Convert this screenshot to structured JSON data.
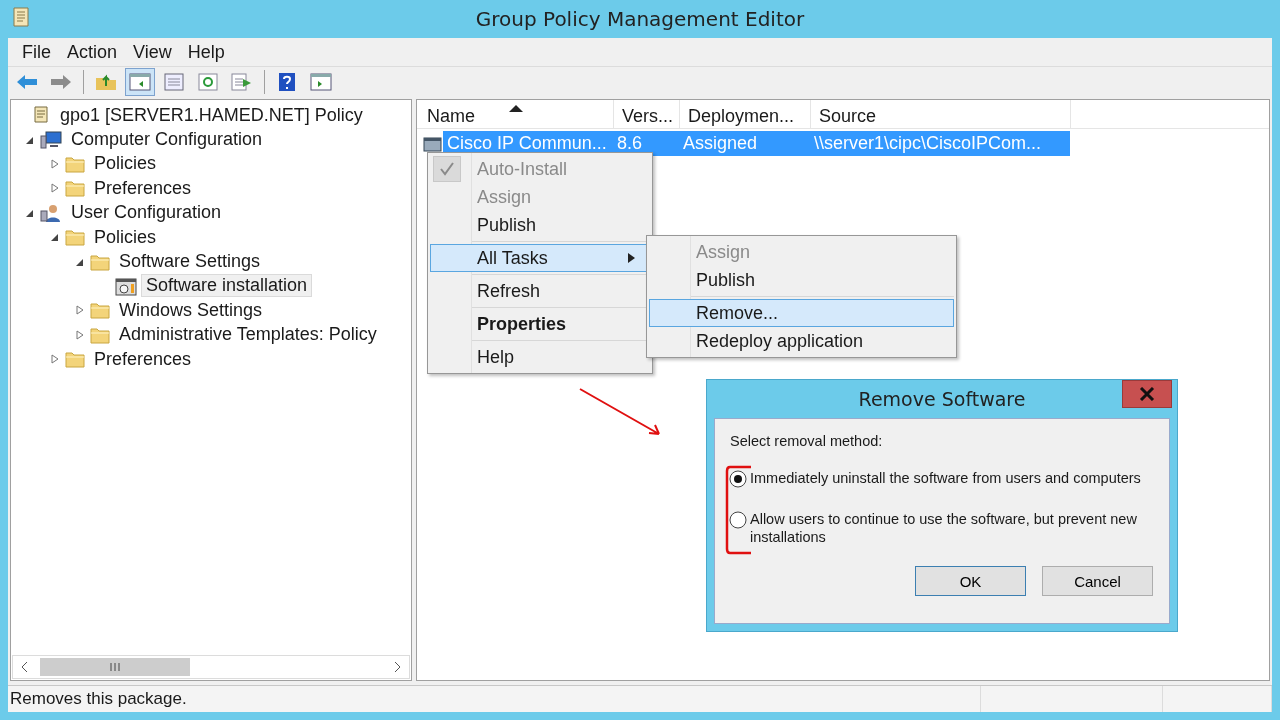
{
  "window": {
    "title": "Group Policy Management Editor"
  },
  "menu_bar": [
    "File",
    "Action",
    "View",
    "Help"
  ],
  "toolbar": [
    {
      "pressed": false
    },
    {
      "pressed": false
    },
    {
      "pressed": false
    },
    {
      "pressed": true
    },
    {
      "pressed": false
    },
    {
      "pressed": false
    },
    {
      "pressed": false
    },
    {
      "pressed": false
    },
    {
      "pressed": false
    }
  ],
  "tree": {
    "label": "gpo1 [SERVER1.HAMED.NET] Policy",
    "kind": "policy",
    "selected": false,
    "children": [
      {
        "label": "Computer Configuration",
        "kind": "computer",
        "expanded": true,
        "selected": false,
        "children": [
          {
            "label": "Policies",
            "kind": "folder",
            "expanded": false,
            "selected": false
          },
          {
            "label": "Preferences",
            "kind": "folder",
            "expanded": false,
            "selected": false
          }
        ]
      },
      {
        "label": "User Configuration",
        "kind": "user",
        "expanded": true,
        "selected": false,
        "children": [
          {
            "label": "Policies",
            "kind": "folder",
            "expanded": true,
            "selected": false,
            "children": [
              {
                "label": "Software Settings",
                "kind": "folder",
                "expanded": true,
                "selected": false,
                "children": [
                  {
                    "label": "Software installation",
                    "kind": "software",
                    "selected": true
                  }
                ]
              },
              {
                "label": "Windows Settings",
                "kind": "folder",
                "expanded": false,
                "selected": false
              },
              {
                "label": "Administrative Templates: Policy",
                "kind": "folder",
                "expanded": false,
                "selected": false
              }
            ]
          },
          {
            "label": "Preferences",
            "kind": "folder",
            "expanded": false,
            "selected": false
          }
        ]
      }
    ]
  },
  "list": {
    "columns": [
      {
        "label": "Name",
        "sorted": true
      },
      {
        "label": "Vers...",
        "sorted": false
      },
      {
        "label": "Deploymen...",
        "sorted": false
      },
      {
        "label": "Source",
        "sorted": false
      }
    ],
    "rows": [
      {
        "cells": [
          "Cisco IP Commun...",
          "8.6",
          "Assigned",
          "\\\\server1\\cipc\\CiscoIPCom..."
        ],
        "selected": true
      }
    ]
  },
  "context_menu": {
    "groups": [
      [
        {
          "label": "Auto-Install",
          "checked": true,
          "disabled": true,
          "highlighted": false,
          "bold": false,
          "submenu": false
        },
        {
          "label": "Assign",
          "checked": false,
          "disabled": true,
          "highlighted": false,
          "bold": false,
          "submenu": false
        },
        {
          "label": "Publish",
          "checked": false,
          "disabled": false,
          "highlighted": false,
          "bold": false,
          "submenu": false
        }
      ],
      [
        {
          "label": "All Tasks",
          "checked": false,
          "disabled": false,
          "highlighted": true,
          "bold": false,
          "submenu": true
        }
      ],
      [
        {
          "label": "Refresh",
          "checked": false,
          "disabled": false,
          "highlighted": false,
          "bold": false,
          "submenu": false
        }
      ],
      [
        {
          "label": "Properties",
          "checked": false,
          "disabled": false,
          "highlighted": false,
          "bold": true,
          "submenu": false
        }
      ],
      [
        {
          "label": "Help",
          "checked": false,
          "disabled": false,
          "highlighted": false,
          "bold": false,
          "submenu": false
        }
      ]
    ]
  },
  "submenu": {
    "groups": [
      [
        {
          "label": "Assign",
          "disabled": true,
          "highlighted": false
        },
        {
          "label": "Publish",
          "disabled": false,
          "highlighted": false
        }
      ],
      [
        {
          "label": "Remove...",
          "disabled": false,
          "highlighted": true
        },
        {
          "label": "Redeploy application",
          "disabled": false,
          "highlighted": false
        }
      ]
    ]
  },
  "dialog": {
    "title": "Remove Software",
    "prompt": "Select removal method:",
    "options": [
      {
        "label": "Immediately uninstall the software from users and computers",
        "selected": true
      },
      {
        "label": "Allow users to continue to use the software, but prevent new installations",
        "selected": false
      }
    ],
    "buttons": [
      {
        "label": "OK",
        "default": true
      },
      {
        "label": "Cancel",
        "default": false
      }
    ]
  },
  "status_bar": {
    "text": "Removes this package."
  }
}
